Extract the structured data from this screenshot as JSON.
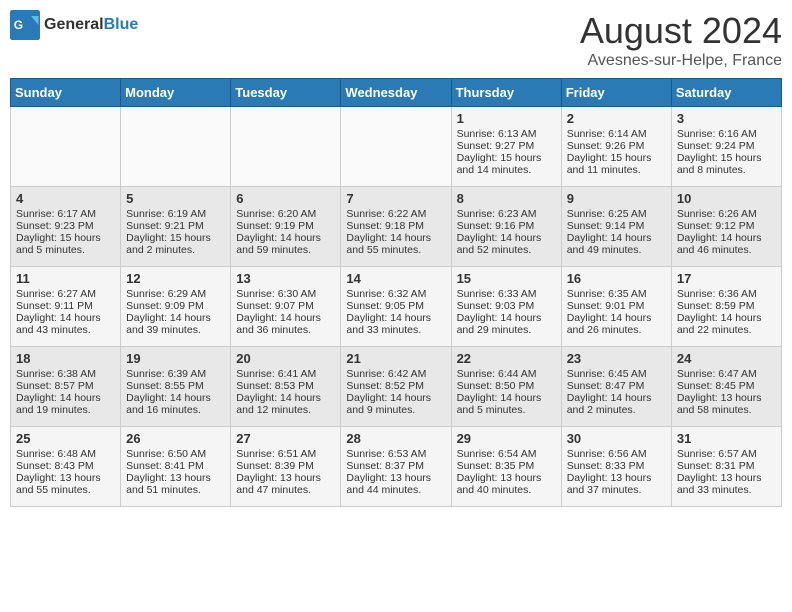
{
  "header": {
    "logo_general": "General",
    "logo_blue": "Blue",
    "month_year": "August 2024",
    "location": "Avesnes-sur-Helpe, France"
  },
  "days_of_week": [
    "Sunday",
    "Monday",
    "Tuesday",
    "Wednesday",
    "Thursday",
    "Friday",
    "Saturday"
  ],
  "weeks": [
    [
      {
        "day": "",
        "sunrise": "",
        "sunset": "",
        "daylight": ""
      },
      {
        "day": "",
        "sunrise": "",
        "sunset": "",
        "daylight": ""
      },
      {
        "day": "",
        "sunrise": "",
        "sunset": "",
        "daylight": ""
      },
      {
        "day": "",
        "sunrise": "",
        "sunset": "",
        "daylight": ""
      },
      {
        "day": "1",
        "sunrise": "Sunrise: 6:13 AM",
        "sunset": "Sunset: 9:27 PM",
        "daylight": "Daylight: 15 hours and 14 minutes."
      },
      {
        "day": "2",
        "sunrise": "Sunrise: 6:14 AM",
        "sunset": "Sunset: 9:26 PM",
        "daylight": "Daylight: 15 hours and 11 minutes."
      },
      {
        "day": "3",
        "sunrise": "Sunrise: 6:16 AM",
        "sunset": "Sunset: 9:24 PM",
        "daylight": "Daylight: 15 hours and 8 minutes."
      }
    ],
    [
      {
        "day": "4",
        "sunrise": "Sunrise: 6:17 AM",
        "sunset": "Sunset: 9:23 PM",
        "daylight": "Daylight: 15 hours and 5 minutes."
      },
      {
        "day": "5",
        "sunrise": "Sunrise: 6:19 AM",
        "sunset": "Sunset: 9:21 PM",
        "daylight": "Daylight: 15 hours and 2 minutes."
      },
      {
        "day": "6",
        "sunrise": "Sunrise: 6:20 AM",
        "sunset": "Sunset: 9:19 PM",
        "daylight": "Daylight: 14 hours and 59 minutes."
      },
      {
        "day": "7",
        "sunrise": "Sunrise: 6:22 AM",
        "sunset": "Sunset: 9:18 PM",
        "daylight": "Daylight: 14 hours and 55 minutes."
      },
      {
        "day": "8",
        "sunrise": "Sunrise: 6:23 AM",
        "sunset": "Sunset: 9:16 PM",
        "daylight": "Daylight: 14 hours and 52 minutes."
      },
      {
        "day": "9",
        "sunrise": "Sunrise: 6:25 AM",
        "sunset": "Sunset: 9:14 PM",
        "daylight": "Daylight: 14 hours and 49 minutes."
      },
      {
        "day": "10",
        "sunrise": "Sunrise: 6:26 AM",
        "sunset": "Sunset: 9:12 PM",
        "daylight": "Daylight: 14 hours and 46 minutes."
      }
    ],
    [
      {
        "day": "11",
        "sunrise": "Sunrise: 6:27 AM",
        "sunset": "Sunset: 9:11 PM",
        "daylight": "Daylight: 14 hours and 43 minutes."
      },
      {
        "day": "12",
        "sunrise": "Sunrise: 6:29 AM",
        "sunset": "Sunset: 9:09 PM",
        "daylight": "Daylight: 14 hours and 39 minutes."
      },
      {
        "day": "13",
        "sunrise": "Sunrise: 6:30 AM",
        "sunset": "Sunset: 9:07 PM",
        "daylight": "Daylight: 14 hours and 36 minutes."
      },
      {
        "day": "14",
        "sunrise": "Sunrise: 6:32 AM",
        "sunset": "Sunset: 9:05 PM",
        "daylight": "Daylight: 14 hours and 33 minutes."
      },
      {
        "day": "15",
        "sunrise": "Sunrise: 6:33 AM",
        "sunset": "Sunset: 9:03 PM",
        "daylight": "Daylight: 14 hours and 29 minutes."
      },
      {
        "day": "16",
        "sunrise": "Sunrise: 6:35 AM",
        "sunset": "Sunset: 9:01 PM",
        "daylight": "Daylight: 14 hours and 26 minutes."
      },
      {
        "day": "17",
        "sunrise": "Sunrise: 6:36 AM",
        "sunset": "Sunset: 8:59 PM",
        "daylight": "Daylight: 14 hours and 22 minutes."
      }
    ],
    [
      {
        "day": "18",
        "sunrise": "Sunrise: 6:38 AM",
        "sunset": "Sunset: 8:57 PM",
        "daylight": "Daylight: 14 hours and 19 minutes."
      },
      {
        "day": "19",
        "sunrise": "Sunrise: 6:39 AM",
        "sunset": "Sunset: 8:55 PM",
        "daylight": "Daylight: 14 hours and 16 minutes."
      },
      {
        "day": "20",
        "sunrise": "Sunrise: 6:41 AM",
        "sunset": "Sunset: 8:53 PM",
        "daylight": "Daylight: 14 hours and 12 minutes."
      },
      {
        "day": "21",
        "sunrise": "Sunrise: 6:42 AM",
        "sunset": "Sunset: 8:52 PM",
        "daylight": "Daylight: 14 hours and 9 minutes."
      },
      {
        "day": "22",
        "sunrise": "Sunrise: 6:44 AM",
        "sunset": "Sunset: 8:50 PM",
        "daylight": "Daylight: 14 hours and 5 minutes."
      },
      {
        "day": "23",
        "sunrise": "Sunrise: 6:45 AM",
        "sunset": "Sunset: 8:47 PM",
        "daylight": "Daylight: 14 hours and 2 minutes."
      },
      {
        "day": "24",
        "sunrise": "Sunrise: 6:47 AM",
        "sunset": "Sunset: 8:45 PM",
        "daylight": "Daylight: 13 hours and 58 minutes."
      }
    ],
    [
      {
        "day": "25",
        "sunrise": "Sunrise: 6:48 AM",
        "sunset": "Sunset: 8:43 PM",
        "daylight": "Daylight: 13 hours and 55 minutes."
      },
      {
        "day": "26",
        "sunrise": "Sunrise: 6:50 AM",
        "sunset": "Sunset: 8:41 PM",
        "daylight": "Daylight: 13 hours and 51 minutes."
      },
      {
        "day": "27",
        "sunrise": "Sunrise: 6:51 AM",
        "sunset": "Sunset: 8:39 PM",
        "daylight": "Daylight: 13 hours and 47 minutes."
      },
      {
        "day": "28",
        "sunrise": "Sunrise: 6:53 AM",
        "sunset": "Sunset: 8:37 PM",
        "daylight": "Daylight: 13 hours and 44 minutes."
      },
      {
        "day": "29",
        "sunrise": "Sunrise: 6:54 AM",
        "sunset": "Sunset: 8:35 PM",
        "daylight": "Daylight: 13 hours and 40 minutes."
      },
      {
        "day": "30",
        "sunrise": "Sunrise: 6:56 AM",
        "sunset": "Sunset: 8:33 PM",
        "daylight": "Daylight: 13 hours and 37 minutes."
      },
      {
        "day": "31",
        "sunrise": "Sunrise: 6:57 AM",
        "sunset": "Sunset: 8:31 PM",
        "daylight": "Daylight: 13 hours and 33 minutes."
      }
    ]
  ]
}
